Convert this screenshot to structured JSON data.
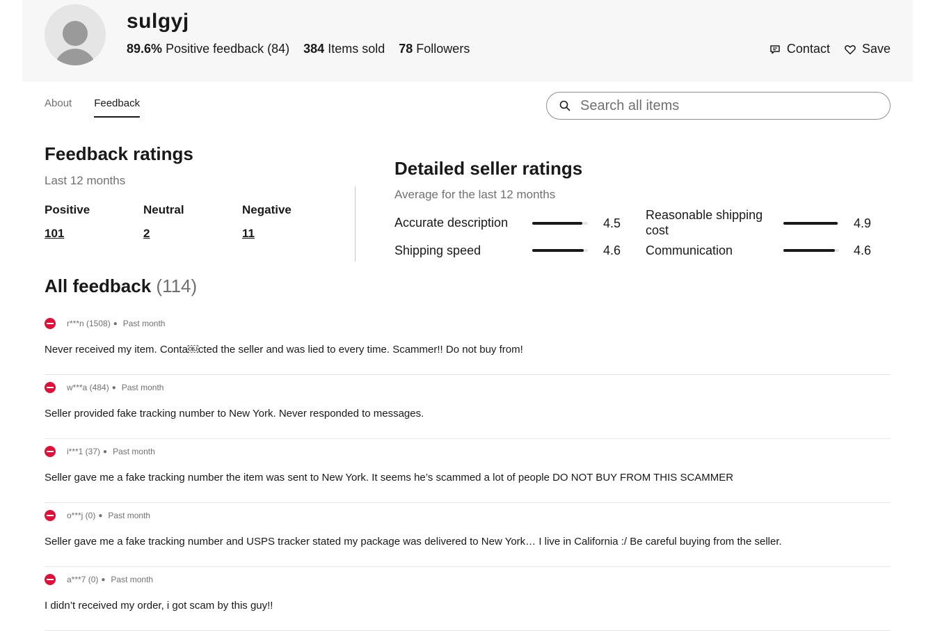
{
  "seller": {
    "name": "sulgyj",
    "positive_pct": "89.6%",
    "positive_label": "Positive feedback (84)",
    "items_sold_num": "384",
    "items_sold_label": "Items sold",
    "followers_num": "78",
    "followers_label": "Followers"
  },
  "actions": {
    "contact": "Contact",
    "save": "Save"
  },
  "tabs": [
    {
      "label": "About",
      "active": false
    },
    {
      "label": "Feedback",
      "active": true
    }
  ],
  "search": {
    "placeholder": "Search all items"
  },
  "feedback_ratings": {
    "title": "Feedback ratings",
    "subtitle": "Last 12 months",
    "positive_label": "Positive",
    "positive_value": "101",
    "neutral_label": "Neutral",
    "neutral_value": "2",
    "negative_label": "Negative",
    "negative_value": "11"
  },
  "detailed_ratings": {
    "title": "Detailed seller ratings",
    "subtitle": "Average for the last 12 months",
    "items": [
      {
        "name": "Accurate description",
        "score": "4.5",
        "value": 4.5
      },
      {
        "name": "Shipping speed",
        "score": "4.6",
        "value": 4.6
      },
      {
        "name": "Reasonable shipping cost",
        "score": "4.9",
        "value": 4.9
      },
      {
        "name": "Communication",
        "score": "4.6",
        "value": 4.6
      }
    ]
  },
  "all_feedback": {
    "title": "All feedback",
    "count": "(114)",
    "items": [
      {
        "user": "r***n (1508)",
        "time": "Past month",
        "text": "Never received my item. Conta￼cted the seller and was lied to every time. Scammer!! Do not buy from!"
      },
      {
        "user": "w***a (484)",
        "time": "Past month",
        "text": "Seller provided fake tracking number to New York. Never responded to messages."
      },
      {
        "user": "i***1 (37)",
        "time": "Past month",
        "text": "Seller gave me a fake tracking number the item was sent to New York. It seems he’s scammed a lot of people DO NOT BUY FROM THIS SCAMMER"
      },
      {
        "user": "o***j (0)",
        "time": "Past month",
        "text": "Seller gave me a fake tracking number and USPS tracker stated my package was delivered to New York… I live in California :/ Be careful buying from the seller."
      },
      {
        "user": "a***7 (0)",
        "time": "Past month",
        "text": "I didn’t received my order, i got scam by this guy!!"
      }
    ]
  }
}
